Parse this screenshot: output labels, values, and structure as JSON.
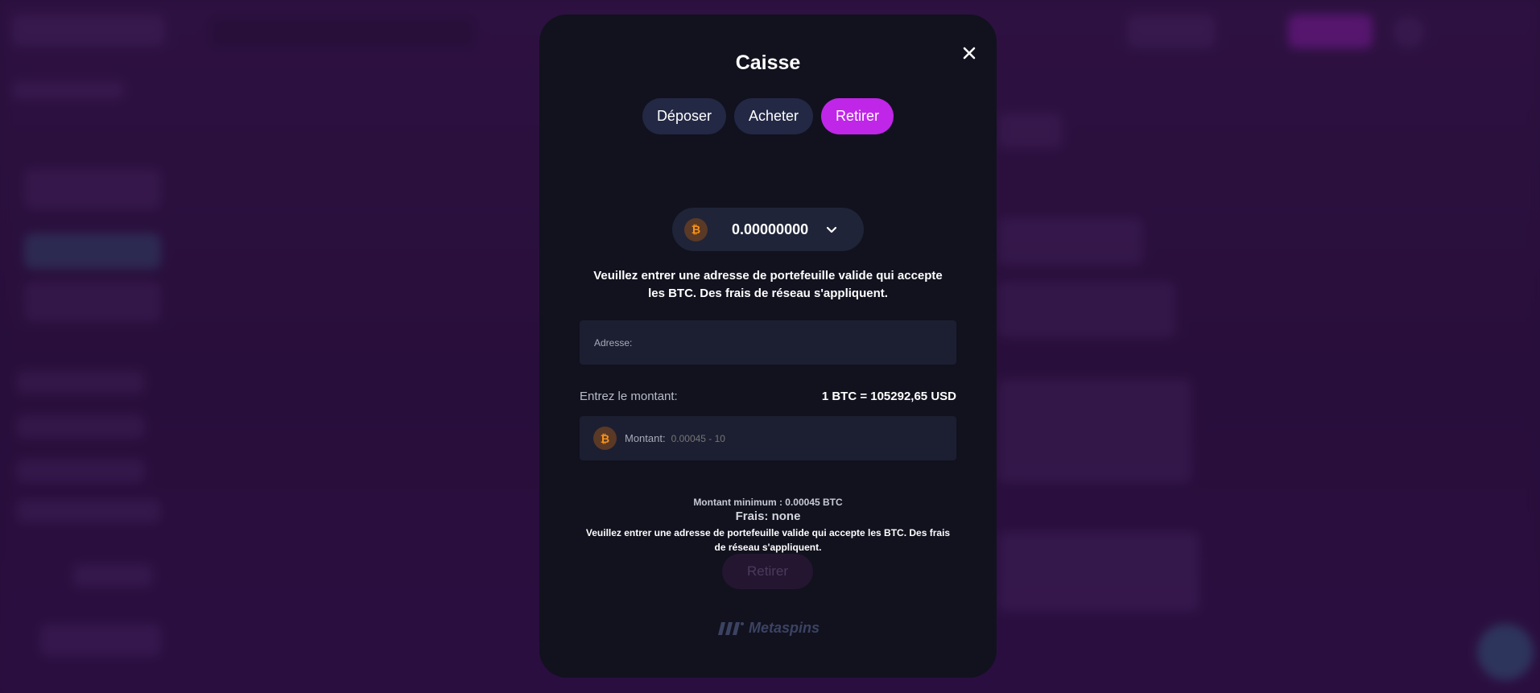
{
  "modal": {
    "title": "Caisse",
    "tabs": [
      {
        "label": "Déposer",
        "active": false
      },
      {
        "label": "Acheter",
        "active": false
      },
      {
        "label": "Retirer",
        "active": true
      }
    ],
    "currency": {
      "symbol": "₿",
      "icon": "bitcoin-icon",
      "balance": "0.00000000"
    },
    "instruction": "Veuillez entrer une adresse de portefeuille valide qui accepte les BTC. Des frais de réseau s'appliquent.",
    "address": {
      "label": "Adresse:",
      "value": "",
      "placeholder": ""
    },
    "amount": {
      "label": "Entrez le montant:",
      "rate": "1 BTC = 105292,65 USD",
      "field_label": "Montant:",
      "placeholder": "0.00045 - 10"
    },
    "notes": {
      "min_amount": "Montant minimum : 0.00045 BTC",
      "fees": "Frais: none",
      "warning": "Veuillez entrer une adresse de portefeuille valide qui accepte les BTC. Des frais de réseau s'appliquent."
    },
    "submit_label": "Retirer",
    "brand": "Metaspins"
  },
  "colors": {
    "modal_bg": "#11121e",
    "tab_bg": "#232845",
    "accent": "#c026e8",
    "field_bg": "#1c1f31",
    "btc_orange": "#f7931a"
  }
}
